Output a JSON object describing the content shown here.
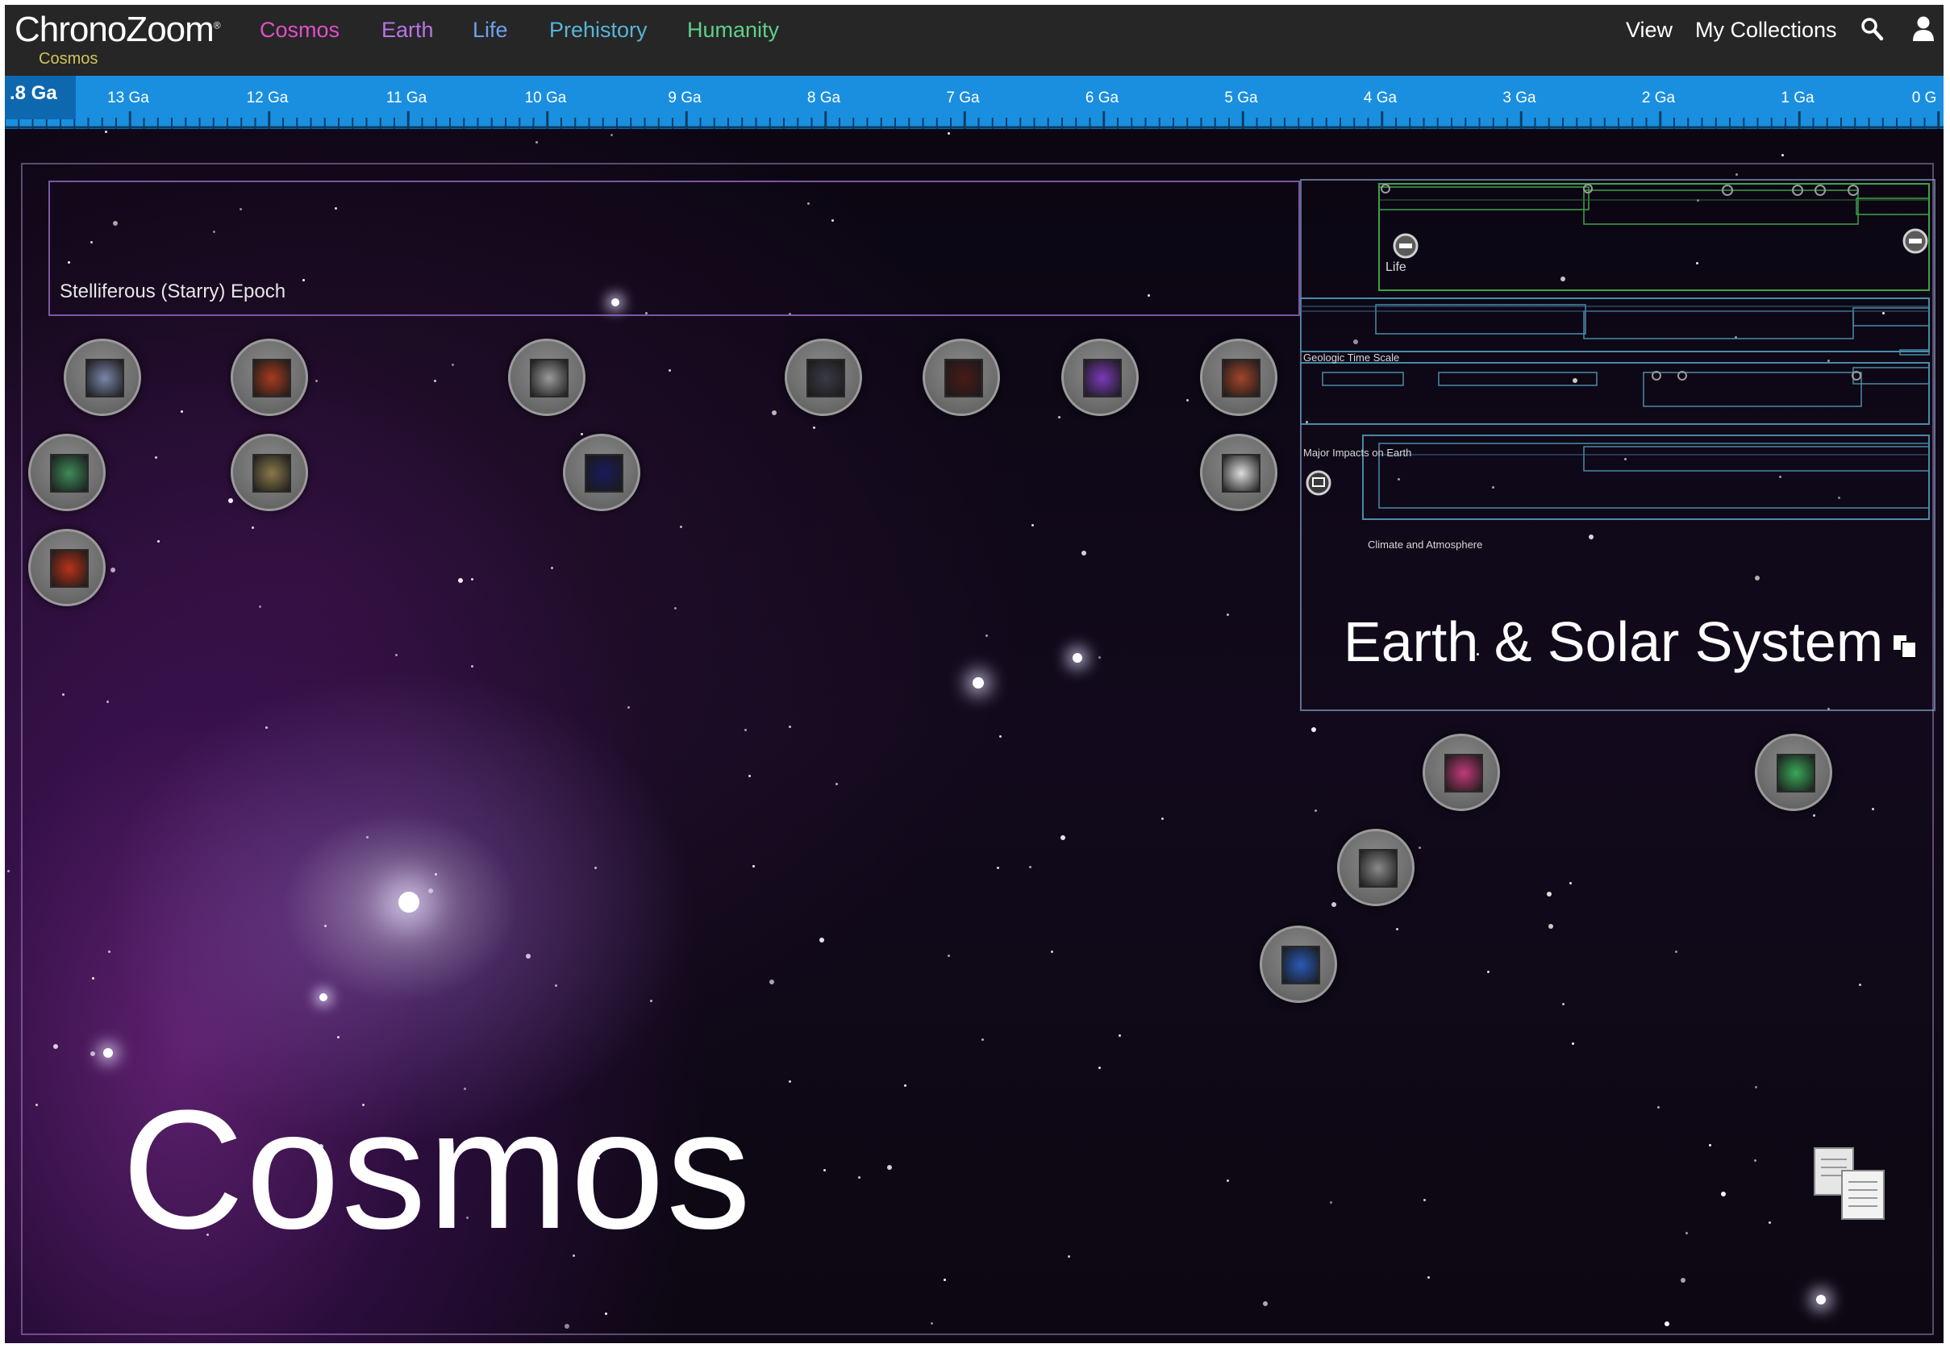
{
  "app": {
    "logo": "ChronoZoom",
    "logo_mark": "®",
    "current_location": "Cosmos"
  },
  "nav": {
    "links": [
      {
        "label": "Cosmos",
        "color": "#e04fc8"
      },
      {
        "label": "Earth",
        "color": "#b873e6"
      },
      {
        "label": "Life",
        "color": "#6f9ff0"
      },
      {
        "label": "Prehistory",
        "color": "#58b4d8"
      },
      {
        "label": "Humanity",
        "color": "#5fd08a"
      }
    ],
    "view_label": "View",
    "collections_label": "My Collections",
    "icons": [
      "search-icon",
      "user-icon"
    ]
  },
  "timescale": {
    "current_label": ".8 Ga",
    "ticks": [
      "13 Ga",
      "12 Ga",
      "11 Ga",
      "10 Ga",
      "9 Ga",
      "8 Ga",
      "7 Ga",
      "6 Ga",
      "5 Ga",
      "4 Ga",
      "3 Ga",
      "2 Ga",
      "1 Ga",
      "0 G"
    ],
    "color": "#1a8fe0"
  },
  "timeline": {
    "epoch_label": "Stelliferous (Starry) Epoch",
    "main_title": "Cosmos",
    "earth_title": "Earth & Solar System",
    "earth_subtimelines": [
      "Life",
      "Geologic Time Scale",
      "Major Impacts on Earth",
      "Climate and Atmosphere"
    ]
  },
  "exhibits": [
    {
      "name": "galaxy-exhibit",
      "thumb": "#7a86a8"
    },
    {
      "name": "supernova-exhibit",
      "thumb": "#a83c1e"
    },
    {
      "name": "star-cluster-exhibit",
      "thumb": "#9a9a9a"
    },
    {
      "name": "deep-field-exhibit",
      "thumb": "#3a3a48"
    },
    {
      "name": "nebula-red-exhibit",
      "thumb": "#4a1a18"
    },
    {
      "name": "galaxy-collision-exhibit",
      "thumb": "#7a3ab8"
    },
    {
      "name": "star-formation-exhibit",
      "thumb": "#a3452a"
    },
    {
      "name": "cmb-map-exhibit",
      "thumb": "#3f8a5a"
    },
    {
      "name": "observatory-exhibit",
      "thumb": "#8a7a4a"
    },
    {
      "name": "dark-matter-exhibit",
      "thumb": "#1a1a5a"
    },
    {
      "name": "quasar-exhibit",
      "thumb": "#dddddd"
    },
    {
      "name": "early-universe-exhibit",
      "thumb": "#b8321a"
    },
    {
      "name": "solar-nebula-exhibit",
      "thumb": "#c23a7a"
    },
    {
      "name": "sun-exhibit",
      "thumb": "#3aa85a"
    },
    {
      "name": "moon-exhibit",
      "thumb": "#8a8a8a"
    },
    {
      "name": "earth-exhibit",
      "thumb": "#2a5ab8"
    }
  ]
}
